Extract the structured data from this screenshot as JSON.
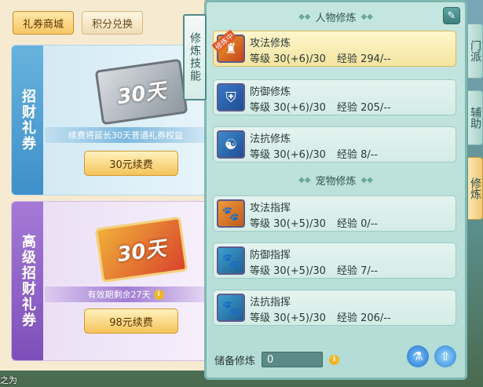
{
  "shop": {
    "tabs": [
      {
        "label": "礼券商城",
        "active": true
      },
      {
        "label": "积分兑换",
        "active": false
      }
    ],
    "card1": {
      "side_label": "招财礼券",
      "ticket_text": "30天",
      "note": "续费将延长30天普通礼券权益",
      "button": "30元续费"
    },
    "card2": {
      "side_label": "高级招财礼券",
      "ticket_text": "30天",
      "note": "有效期剩余27天",
      "button": "98元续费"
    }
  },
  "cultivation": {
    "vertical_tab": "修炼技能",
    "section_person": "人物修炼",
    "section_pet": "宠物修炼",
    "level_label": "等级",
    "exp_label": "经验",
    "badge": "修炼中",
    "person_skills": [
      {
        "name": "攻法修炼",
        "level": "30(+6)/30",
        "exp": "294/--",
        "icon": "attack-magic-icon",
        "selected": true
      },
      {
        "name": "防御修炼",
        "level": "30(+6)/30",
        "exp": "205/--",
        "icon": "defense-icon",
        "selected": false
      },
      {
        "name": "法抗修炼",
        "level": "30(+6)/30",
        "exp": "8/--",
        "icon": "magic-resist-icon",
        "selected": false
      }
    ],
    "pet_skills": [
      {
        "name": "攻法指挥",
        "level": "30(+5)/30",
        "exp": "0/--",
        "icon": "pet-attack-icon"
      },
      {
        "name": "防御指挥",
        "level": "30(+5)/30",
        "exp": "7/--",
        "icon": "pet-defense-icon"
      },
      {
        "name": "法抗指挥",
        "level": "30(+5)/30",
        "exp": "206/--",
        "icon": "pet-resist-icon"
      }
    ],
    "footer_label": "储备修炼",
    "footer_value": "0"
  },
  "side_tabs": [
    {
      "label": "门派",
      "active": false
    },
    {
      "label": "辅助",
      "active": false
    },
    {
      "label": "修炼",
      "active": true
    }
  ],
  "bottom_text": "之为",
  "colors": {
    "accent": "#f5c35a",
    "panel": "#b3dcd5",
    "border": "#7fb8b1"
  }
}
